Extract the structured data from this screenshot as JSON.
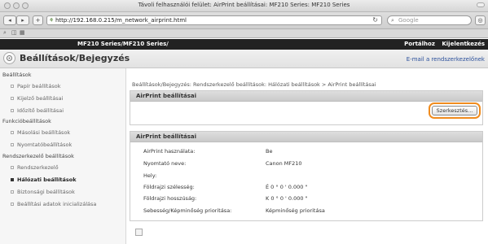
{
  "window": {
    "title": "Távoli felhasználói felület: AirPrint beállításai: MF210 Series: MF210 Series",
    "url": "http://192.168.0.215/m_network_airprint.html",
    "search_placeholder": "Google"
  },
  "header": {
    "device": "MF210 Series/MF210 Series/",
    "portal_link": "Portálhoz",
    "logout_link": "Kijelentkezés",
    "page_title": "Beállítások/Bejegyzés",
    "email_link": "E-mail a rendszerkezelőnek"
  },
  "sidebar": {
    "sections": [
      {
        "label": "Beállítások",
        "items": [
          {
            "label": "Papír beállítások",
            "selected": false
          },
          {
            "label": "Kijelző beállításai",
            "selected": false
          },
          {
            "label": "Időzítő beállításai",
            "selected": false
          }
        ]
      },
      {
        "label": "Funkcióbeállítások",
        "items": [
          {
            "label": "Másolási beállítások",
            "selected": false
          },
          {
            "label": "Nyomtatóbeállítások",
            "selected": false
          }
        ]
      },
      {
        "label": "Rendszerkezelő beállítások",
        "items": [
          {
            "label": "Rendszerkezelő",
            "selected": false
          },
          {
            "label": "Hálózati beállítások",
            "selected": true
          },
          {
            "label": "Biztonsági beállítások",
            "selected": false
          },
          {
            "label": "Beállítási adatok inicializálása",
            "selected": false
          }
        ]
      }
    ]
  },
  "main": {
    "breadcrumb": "Beállítások/Bejegyzés: Rendszerkezelő beállítások: Hálózati beállítások > AirPrint beállításai",
    "panel1_title": "AirPrint beállításai",
    "edit_button": "Szerkesztés...",
    "panel2_title": "AirPrint beállításai",
    "rows": [
      {
        "label": "AirPrint használata:",
        "value": "Be"
      },
      {
        "label": "Nyomtató neve:",
        "value": "Canon MF210"
      },
      {
        "label": "Hely:",
        "value": ""
      },
      {
        "label": "Földrajzi szélesség:",
        "value": "É 0 ° 0 ' 0.000 \""
      },
      {
        "label": "Földrajzi hosszúság:",
        "value": "K 0 ° 0 ' 0.000 \""
      },
      {
        "label": "Sebesség/Képminőség prioritása:",
        "value": "Képminőség prioritása"
      }
    ]
  }
}
